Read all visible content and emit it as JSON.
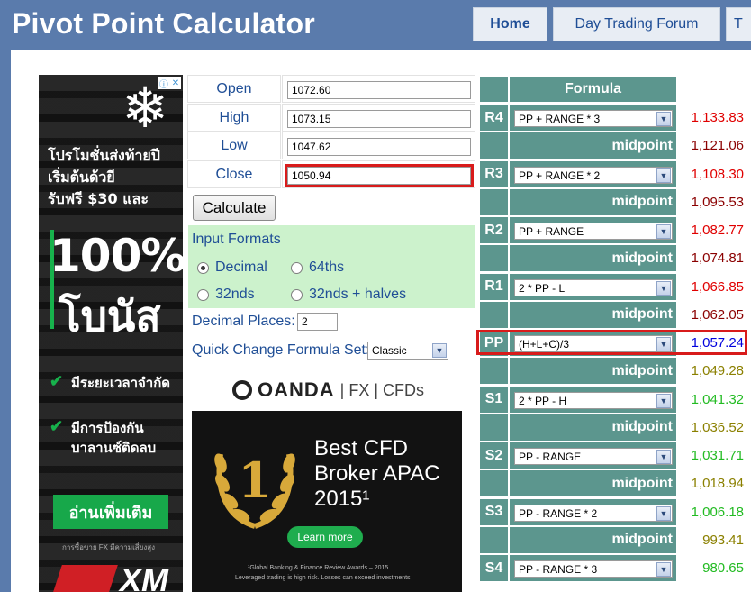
{
  "site": {
    "title": "Pivot Point Calculator",
    "nav": [
      "Home",
      "Day Trading Forum",
      "T"
    ]
  },
  "left_ad": {
    "line1": "โปรโมชั่นส่งท้ายปี",
    "line2": "เริ่มต้นด้วยี",
    "line3": "รับฟรี $30 และ",
    "big1": "100%",
    "big2": "โบนัส",
    "check1": "มีระยะเวลาจำกัด",
    "check2a": "มีการป้องกัน",
    "check2b": "บาลานซ์ติดลบ",
    "cta": "อ่านเพิ่มเติม",
    "warning": "การซื้อขาย FX มีความเสี่ยงสูง",
    "logo": "XM"
  },
  "inputs": {
    "open_label": "Open",
    "open_value": "1072.60",
    "high_label": "High",
    "high_value": "1073.15",
    "low_label": "Low",
    "low_value": "1047.62",
    "close_label": "Close",
    "close_value": "1050.94",
    "calculate_label": "Calculate"
  },
  "input_formats": {
    "title": "Input Formats",
    "options": [
      "Decimal",
      "64ths",
      "32nds",
      "32nds + halves"
    ],
    "selected": "Decimal"
  },
  "decimal_places": {
    "label": "Decimal Places:",
    "value": "2"
  },
  "quick_change": {
    "label": "Quick Change Formula Set:",
    "selected": "Classic"
  },
  "oanda_ad": {
    "brand": "OANDA",
    "tail": "| FX | CFDs",
    "line1": "Best CFD",
    "line2": "Broker APAC",
    "line3": "2015¹",
    "learn_more": "Learn more",
    "fine1": "¹Global Banking & Finance Review Awards – 2015",
    "fine2": "Leveraged trading is high risk. Losses can exceed investments"
  },
  "formula_table": {
    "header": "Formula",
    "midpoint_label": "midpoint",
    "rows": [
      {
        "label": "R4",
        "formula": "PP + RANGE * 3",
        "value": "1,133.83",
        "color": "#e00000"
      },
      {
        "mid": true,
        "value": "1,121.06",
        "color": "#8b0000"
      },
      {
        "label": "R3",
        "formula": "PP + RANGE * 2",
        "value": "1,108.30",
        "color": "#e00000"
      },
      {
        "mid": true,
        "value": "1,095.53",
        "color": "#8b0000"
      },
      {
        "label": "R2",
        "formula": "PP + RANGE",
        "value": "1,082.77",
        "color": "#e00000"
      },
      {
        "mid": true,
        "value": "1,074.81",
        "color": "#8b0000"
      },
      {
        "label": "R1",
        "formula": "2 * PP - L",
        "value": "1,066.85",
        "color": "#e00000"
      },
      {
        "mid": true,
        "value": "1,062.05",
        "color": "#8b0000"
      },
      {
        "label": "PP",
        "formula": "(H+L+C)/3",
        "value": "1,057.24",
        "color": "#0000dd"
      },
      {
        "mid": true,
        "value": "1,049.28",
        "color": "#8b8000"
      },
      {
        "label": "S1",
        "formula": "2 * PP - H",
        "value": "1,041.32",
        "color": "#22bb22"
      },
      {
        "mid": true,
        "value": "1,036.52",
        "color": "#8b8000"
      },
      {
        "label": "S2",
        "formula": "PP - RANGE",
        "value": "1,031.71",
        "color": "#22bb22"
      },
      {
        "mid": true,
        "value": "1,018.94",
        "color": "#8b8000"
      },
      {
        "label": "S3",
        "formula": "PP - RANGE * 2",
        "value": "1,006.18",
        "color": "#22bb22"
      },
      {
        "mid": true,
        "value": "993.41",
        "color": "#8b8000"
      },
      {
        "label": "S4",
        "formula": "PP - RANGE * 3",
        "value": "980.65",
        "color": "#22bb22"
      }
    ]
  }
}
